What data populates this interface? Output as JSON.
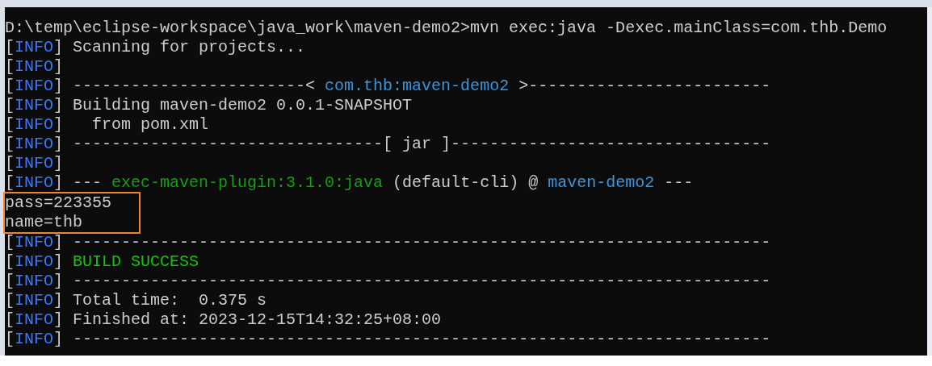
{
  "console": {
    "lines": [
      {
        "highlighted": false,
        "segments": [
          {
            "text": "D:\\temp\\eclipse-workspace\\java_work\\maven-demo2>mvn exec:java -Dexec.mainClass=com.thb.Demo",
            "kind": "plain"
          }
        ]
      },
      {
        "highlighted": false,
        "segments": [
          {
            "text": "[",
            "kind": "plain"
          },
          {
            "text": "INFO",
            "kind": "level"
          },
          {
            "text": "] Scanning for projects...",
            "kind": "plain"
          }
        ]
      },
      {
        "highlighted": false,
        "segments": [
          {
            "text": "[",
            "kind": "plain"
          },
          {
            "text": "INFO",
            "kind": "level"
          },
          {
            "text": "]",
            "kind": "plain"
          }
        ]
      },
      {
        "highlighted": false,
        "segments": [
          {
            "text": "[",
            "kind": "plain"
          },
          {
            "text": "INFO",
            "kind": "level"
          },
          {
            "text": "] ------------------------< ",
            "kind": "plain"
          },
          {
            "text": "com.thb:maven-demo2",
            "kind": "artifact"
          },
          {
            "text": " >-------------------------",
            "kind": "plain"
          }
        ]
      },
      {
        "highlighted": false,
        "segments": [
          {
            "text": "[",
            "kind": "plain"
          },
          {
            "text": "INFO",
            "kind": "level"
          },
          {
            "text": "] Building maven-demo2 0.0.1-SNAPSHOT",
            "kind": "plain"
          }
        ]
      },
      {
        "highlighted": false,
        "segments": [
          {
            "text": "[",
            "kind": "plain"
          },
          {
            "text": "INFO",
            "kind": "level"
          },
          {
            "text": "]   from pom.xml",
            "kind": "plain"
          }
        ]
      },
      {
        "highlighted": false,
        "segments": [
          {
            "text": "[",
            "kind": "plain"
          },
          {
            "text": "INFO",
            "kind": "level"
          },
          {
            "text": "] --------------------------------[ jar ]---------------------------------",
            "kind": "plain"
          }
        ]
      },
      {
        "highlighted": false,
        "segments": [
          {
            "text": "[",
            "kind": "plain"
          },
          {
            "text": "INFO",
            "kind": "level"
          },
          {
            "text": "]",
            "kind": "plain"
          }
        ]
      },
      {
        "highlighted": false,
        "segments": [
          {
            "text": "[",
            "kind": "plain"
          },
          {
            "text": "INFO",
            "kind": "level"
          },
          {
            "text": "] --- ",
            "kind": "plain"
          },
          {
            "text": "exec-maven-plugin:3.1.0:java",
            "kind": "plugin"
          },
          {
            "text": " (default-cli) @ ",
            "kind": "plain"
          },
          {
            "text": "maven-demo2",
            "kind": "artifact"
          },
          {
            "text": " ---",
            "kind": "plain"
          }
        ]
      },
      {
        "highlighted": true,
        "segments": [
          {
            "text": "pass=223355",
            "kind": "plain"
          }
        ]
      },
      {
        "highlighted": true,
        "segments": [
          {
            "text": "name=thb",
            "kind": "plain"
          }
        ]
      },
      {
        "highlighted": false,
        "segments": [
          {
            "text": "[",
            "kind": "plain"
          },
          {
            "text": "INFO",
            "kind": "level"
          },
          {
            "text": "] ------------------------------------------------------------------------",
            "kind": "plain"
          }
        ]
      },
      {
        "highlighted": false,
        "segments": [
          {
            "text": "[",
            "kind": "plain"
          },
          {
            "text": "INFO",
            "kind": "level"
          },
          {
            "text": "] ",
            "kind": "plain"
          },
          {
            "text": "BUILD SUCCESS",
            "kind": "success"
          }
        ]
      },
      {
        "highlighted": false,
        "segments": [
          {
            "text": "[",
            "kind": "plain"
          },
          {
            "text": "INFO",
            "kind": "level"
          },
          {
            "text": "] ------------------------------------------------------------------------",
            "kind": "plain"
          }
        ]
      },
      {
        "highlighted": false,
        "segments": [
          {
            "text": "[",
            "kind": "plain"
          },
          {
            "text": "INFO",
            "kind": "level"
          },
          {
            "text": "] Total time:  0.375 s",
            "kind": "plain"
          }
        ]
      },
      {
        "highlighted": false,
        "segments": [
          {
            "text": "[",
            "kind": "plain"
          },
          {
            "text": "INFO",
            "kind": "level"
          },
          {
            "text": "] Finished at: 2023-12-15T14:32:25+08:00",
            "kind": "plain"
          }
        ]
      },
      {
        "highlighted": false,
        "segments": [
          {
            "text": "[",
            "kind": "plain"
          },
          {
            "text": "INFO",
            "kind": "level"
          },
          {
            "text": "] ------------------------------------------------------------------------",
            "kind": "plain"
          }
        ]
      }
    ]
  }
}
